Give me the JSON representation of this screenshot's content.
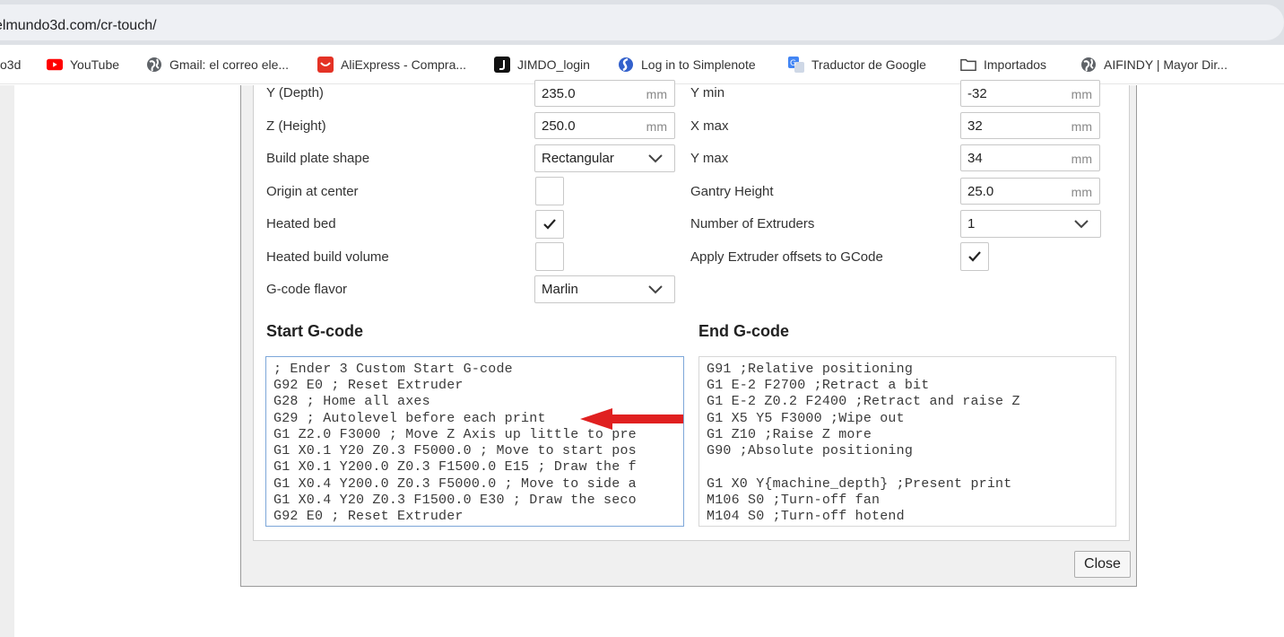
{
  "browser": {
    "url": "elmundo3d.com/cr-touch/",
    "bookmarks": [
      {
        "label": "o3d",
        "icon": "partial-icon"
      },
      {
        "label": "YouTube",
        "icon": "youtube-icon"
      },
      {
        "label": "Gmail: el correo ele...",
        "icon": "globe-icon"
      },
      {
        "label": "AliExpress - Compra...",
        "icon": "aliexpress-icon"
      },
      {
        "label": "JIMDO_login",
        "icon": "jimdo-icon"
      },
      {
        "label": "Log in to Simplenote",
        "icon": "simplenote-icon"
      },
      {
        "label": "Traductor de Google",
        "icon": "google-translate-icon"
      },
      {
        "label": "Importados",
        "icon": "folder-icon"
      },
      {
        "label": "AIFINDY | Mayor Dir...",
        "icon": "globe-icon"
      }
    ]
  },
  "printer": {
    "left": [
      {
        "label": "Y (Depth)",
        "value": "235.0",
        "unit": "mm"
      },
      {
        "label": "Z (Height)",
        "value": "250.0",
        "unit": "mm"
      },
      {
        "label": "Build plate shape",
        "value": "Rectangular"
      },
      {
        "label": "Origin at center"
      },
      {
        "label": "Heated bed"
      },
      {
        "label": "Heated build volume"
      },
      {
        "label": "G-code flavor",
        "value": "Marlin"
      }
    ],
    "right": [
      {
        "label": "Y min",
        "value": "-32",
        "unit": "mm"
      },
      {
        "label": "X max",
        "value": "32",
        "unit": "mm"
      },
      {
        "label": "Y max",
        "value": "34",
        "unit": "mm"
      },
      {
        "label": "Gantry Height",
        "value": "25.0",
        "unit": "mm"
      },
      {
        "label": "Number of Extruders",
        "value": "1"
      },
      {
        "label": "Apply Extruder offsets to GCode"
      }
    ],
    "checks": {
      "origin_at_center": false,
      "heated_bed": true,
      "heated_build_volume": false,
      "apply_extruder_offsets": true
    }
  },
  "start_gcode": {
    "title": "Start G-code",
    "lines": [
      "; Ender 3 Custom Start G-code",
      "G92 E0 ; Reset Extruder",
      "G28 ; Home all axes",
      "G29 ; Autolevel before each print",
      "G1 Z2.0 F3000 ; Move Z Axis up little to pre",
      "G1 X0.1 Y20 Z0.3 F5000.0 ; Move to start pos",
      "G1 X0.1 Y200.0 Z0.3 F1500.0 E15 ; Draw the f",
      "G1 X0.4 Y200.0 Z0.3 F5000.0 ; Move to side a",
      "G1 X0.4 Y20 Z0.3 F1500.0 E30 ; Draw the seco",
      "G92 E0 ; Reset Extruder"
    ]
  },
  "end_gcode": {
    "title": "End G-code",
    "lines": [
      "G91 ;Relative positioning",
      "G1 E-2 F2700 ;Retract a bit",
      "G1 E-2 Z0.2 F2400 ;Retract and raise Z",
      "G1 X5 Y5 F3000 ;Wipe out",
      "G1 Z10 ;Raise Z more",
      "G90 ;Absolute positioning",
      "",
      "G1 X0 Y{machine_depth} ;Present print",
      "M106 S0 ;Turn-off fan",
      "M104 S0 ;Turn-off hotend"
    ]
  },
  "dialog": {
    "close_label": "Close"
  },
  "annotation": {
    "arrow_color": "#e02020"
  }
}
